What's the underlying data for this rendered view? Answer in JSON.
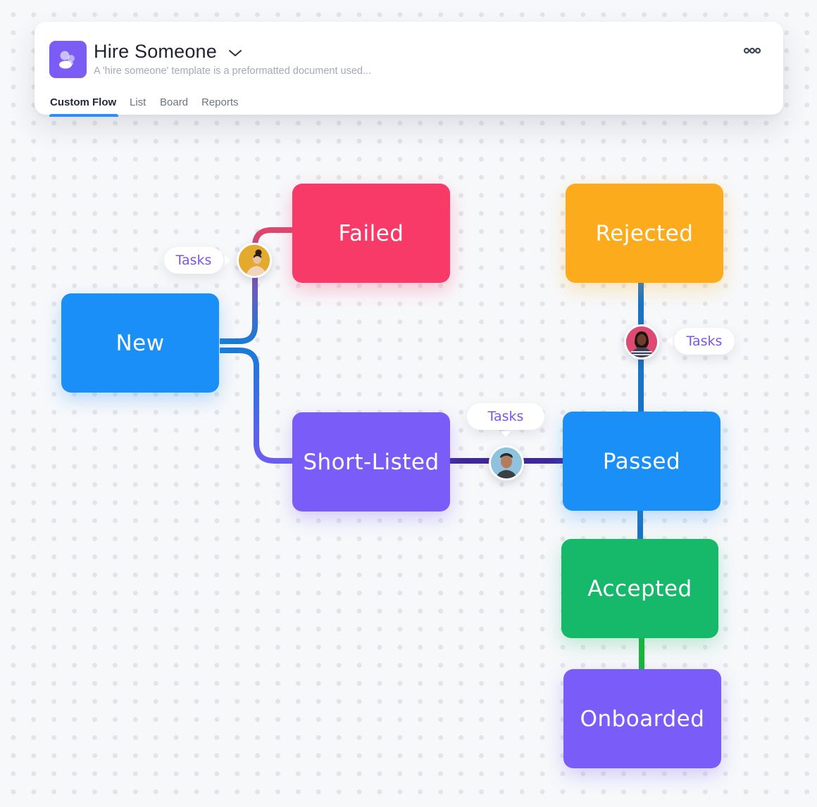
{
  "header": {
    "title": "Hire Someone",
    "subtitle": "A 'hire someone' template is a preformatted document used...",
    "icon": "people-icon",
    "more_icon": "more-options-icon",
    "tabs": [
      {
        "label": "Custom Flow",
        "active": true
      },
      {
        "label": "List",
        "active": false
      },
      {
        "label": "Board",
        "active": false
      },
      {
        "label": "Reports",
        "active": false
      }
    ]
  },
  "flow": {
    "nodes": [
      {
        "id": "new",
        "label": "New",
        "color": "#1a8ff7"
      },
      {
        "id": "failed",
        "label": "Failed",
        "color": "#f73a68"
      },
      {
        "id": "rejected",
        "label": "Rejected",
        "color": "#fbab1b"
      },
      {
        "id": "short-listed",
        "label": "Short-Listed",
        "color": "#7a5cf8"
      },
      {
        "id": "passed",
        "label": "Passed",
        "color": "#1a8ff7"
      },
      {
        "id": "accepted",
        "label": "Accepted",
        "color": "#16b86a"
      },
      {
        "id": "onboarded",
        "label": "Onboarded",
        "color": "#7a5cf8"
      }
    ],
    "task_bubbles": [
      {
        "label": "Tasks",
        "link": "new-to-failed"
      },
      {
        "label": "Tasks",
        "link": "short-listed-to-passed"
      },
      {
        "label": "Tasks",
        "link": "passed-to-rejected"
      }
    ],
    "avatars": [
      {
        "name": "avatar-woman-yellow-bg",
        "bg": "#e3aa2e"
      },
      {
        "name": "avatar-man-blue-bg",
        "bg": "#8fc3dd"
      },
      {
        "name": "avatar-woman-pink-bg",
        "bg": "#df4a73"
      }
    ]
  }
}
